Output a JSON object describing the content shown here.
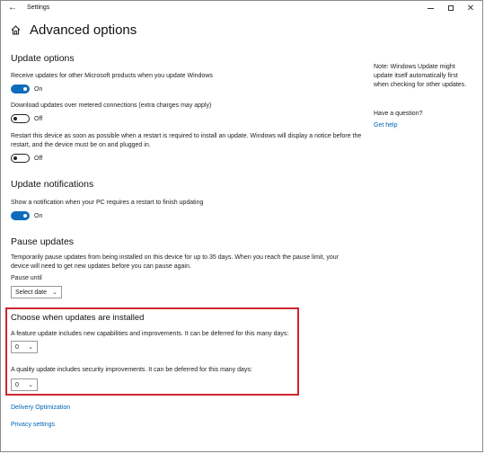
{
  "window": {
    "title": "Settings"
  },
  "header": {
    "title": "Advanced options"
  },
  "update_options": {
    "heading": "Update options",
    "items": [
      {
        "label": "Receive updates for other Microsoft products when you update Windows",
        "state": "On"
      },
      {
        "label": "Download updates over metered connections (extra charges may apply)",
        "state": "Off"
      },
      {
        "label_line1": "Restart this device as soon as possible when a restart is required to install an update. Windows will display a notice before the",
        "label_line2": "restart, and the device must be on and plugged in.",
        "state": "Off"
      }
    ]
  },
  "update_notifications": {
    "heading": "Update notifications",
    "label": "Show a notification when your PC requires a restart to finish updating",
    "state": "On"
  },
  "pause_updates": {
    "heading": "Pause updates",
    "desc_line1": "Temporarily pause updates from being installed on this device for up to 35 days. When you reach the pause limit, your",
    "desc_line2": "device will need to get new updates before you can pause again.",
    "pause_until_label": "Pause until",
    "select_value": "Select date"
  },
  "defer": {
    "heading": "Choose when updates are installed",
    "feature_label": "A feature update includes new capabilities and improvements. It can be deferred for this many days:",
    "feature_value": "0",
    "quality_label": "A quality update includes security improvements. It can be deferred for this many days:",
    "quality_value": "0"
  },
  "links": {
    "delivery": "Delivery Optimization",
    "privacy": "Privacy settings"
  },
  "side": {
    "note_line1": "Note: Windows Update might",
    "note_line2": "update itself automatically first",
    "note_line3": "when checking for other updates.",
    "question": "Have a question?",
    "help": "Get help"
  },
  "colors": {
    "accent": "#0f6cbd",
    "link": "#0063b1",
    "highlight_border": "#d0252f"
  },
  "icons": {
    "back": "back-arrow-icon",
    "home": "home-icon",
    "chevron": "chevron-down-icon"
  }
}
